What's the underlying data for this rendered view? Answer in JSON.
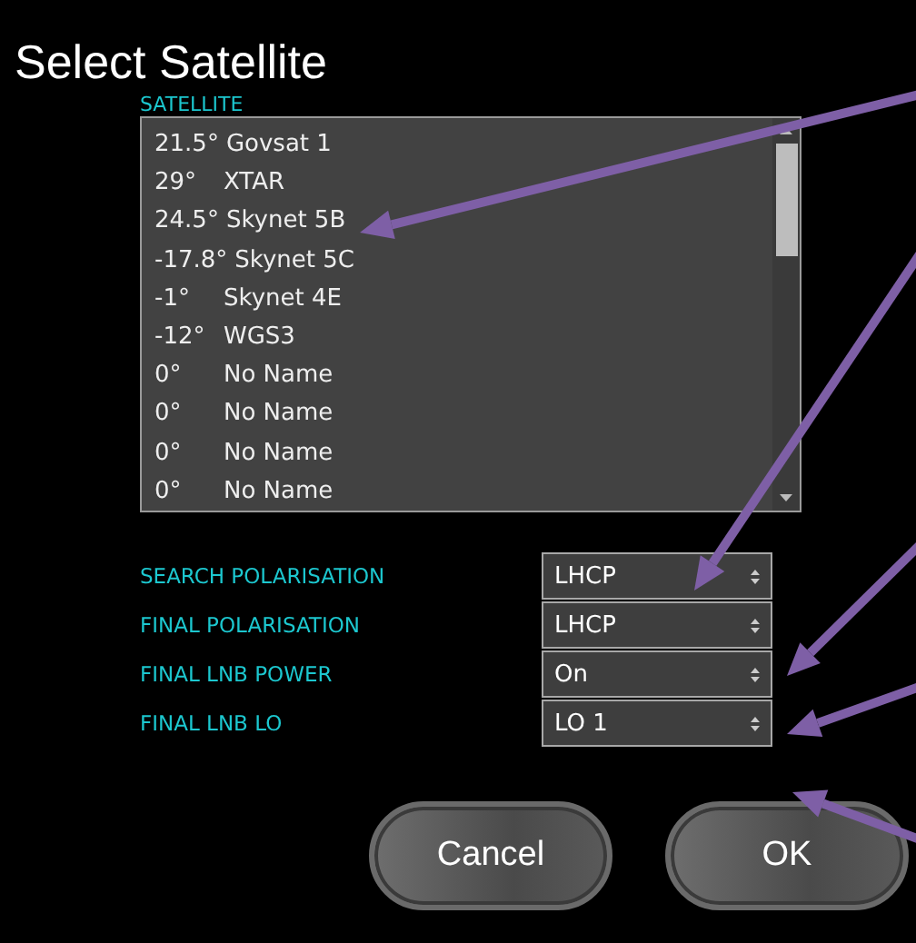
{
  "window": {
    "title": "Select Satellite"
  },
  "satellite_list": {
    "label": "SATELLITE",
    "items": [
      {
        "position": "21.5°",
        "name": "Govsat 1"
      },
      {
        "position": "29°",
        "name": "XTAR"
      },
      {
        "position": "24.5°",
        "name": "Skynet 5B"
      },
      {
        "position": "-17.8°",
        "name": "Skynet 5C"
      },
      {
        "position": "-1°",
        "name": "Skynet 4E"
      },
      {
        "position": "-12°",
        "name": "WGS3"
      },
      {
        "position": "0°",
        "name": "No Name"
      },
      {
        "position": "0°",
        "name": "No Name"
      },
      {
        "position": "0°",
        "name": "No Name"
      },
      {
        "position": "0°",
        "name": "No Name"
      }
    ]
  },
  "settings": [
    {
      "label": "SEARCH POLARISATION",
      "value": "LHCP"
    },
    {
      "label": "FINAL POLARISATION",
      "value": "LHCP"
    },
    {
      "label": "FINAL LNB POWER",
      "value": "On"
    },
    {
      "label": "FINAL LNB LO",
      "value": "LO 1"
    }
  ],
  "buttons": [
    "Cancel",
    "OK"
  ]
}
